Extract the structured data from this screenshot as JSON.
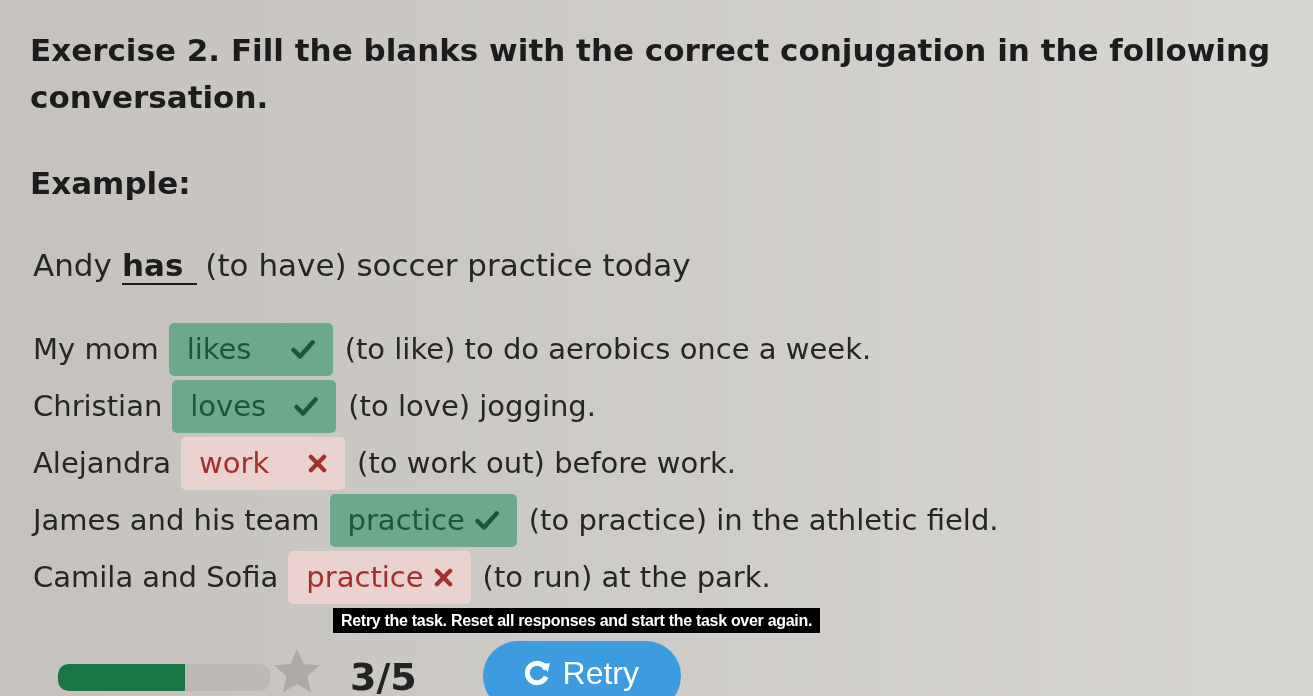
{
  "title": "Exercise 2. Fill the blanks with the correct conjugation in the following conversation.",
  "example": {
    "heading": "Example:",
    "subject": "Andy",
    "answer": "has",
    "hint": "(to have) soccer practice today"
  },
  "items": [
    {
      "subject": "My mom",
      "answer": "likes",
      "correct": true,
      "hint": "(to like) to do aerobics once a week."
    },
    {
      "subject": "Christian",
      "answer": "loves",
      "correct": true,
      "hint": "(to love) jogging."
    },
    {
      "subject": "Alejandra",
      "answer": "work",
      "correct": false,
      "hint": "(to work out) before work."
    },
    {
      "subject": "James and his team",
      "answer": "practice",
      "correct": true,
      "hint": "(to practice) in the athletic field."
    },
    {
      "subject": "Camila and Sofia",
      "answer": "practice",
      "correct": false,
      "hint": "(to run) at the park."
    }
  ],
  "tooltip": "Retry the task. Reset all responses and start the task over again.",
  "progress": {
    "level": 0.6
  },
  "score": "3/5",
  "retry_button": "Retry"
}
